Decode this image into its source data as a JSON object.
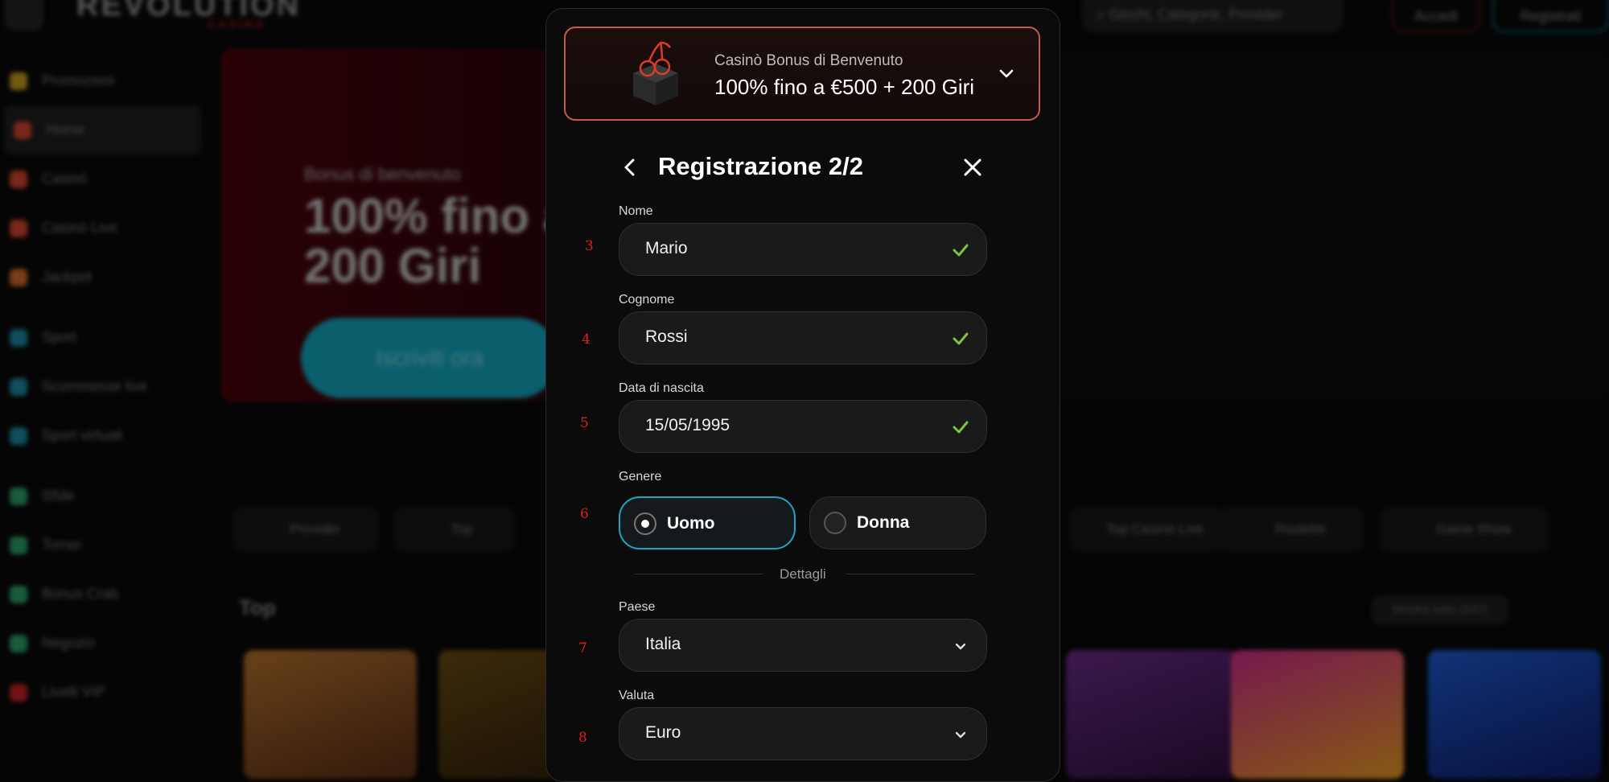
{
  "background": {
    "logo_main": "REVOLUTION",
    "logo_sub": "CASINO",
    "search_placeholder": "Giochi, Categorie, Provider",
    "login_label": "Accedi",
    "register_label": "Registrati",
    "sidebar": [
      {
        "label": "Promozioni",
        "color": "#c9a21b"
      },
      {
        "label": "Home",
        "color": "#d8452b"
      },
      {
        "label": "Casinò",
        "color": "#d8452b"
      },
      {
        "label": "Casinò Live",
        "color": "#d8452b"
      },
      {
        "label": "Jackpot",
        "color": "#d86a2b"
      },
      {
        "label": "Sport",
        "color": "#1a8aa3"
      },
      {
        "label": "Scommesse live",
        "color": "#1a8aa3"
      },
      {
        "label": "Sport virtuali",
        "color": "#1a8aa3"
      },
      {
        "label": "Sfide",
        "color": "#2ba36a"
      },
      {
        "label": "Tornei",
        "color": "#2ba36a"
      },
      {
        "label": "Bonus Crab",
        "color": "#2ba36a"
      },
      {
        "label": "Negozio",
        "color": "#2ba36a"
      },
      {
        "label": "Livelli VIP",
        "color": "#c92020"
      }
    ],
    "banner": {
      "small": "Bonus di benvenuto",
      "big": "100% fino a + 200 Giri",
      "cta": "Iscriviti ora"
    },
    "categories": [
      "Provider",
      "Top",
      "Top Casinò Live",
      "Roulette",
      "Game Show"
    ],
    "section_title": "Top",
    "show_all": "Mostra tutto (337)"
  },
  "modal": {
    "promo": {
      "subtitle": "Casinò Bonus di Benvenuto",
      "title": "100% fino a €500 + 200 Giri"
    },
    "header": {
      "title": "Registrazione 2/2"
    },
    "fields": {
      "first_name": {
        "label": "Nome",
        "value": "Mario",
        "marker": "3"
      },
      "last_name": {
        "label": "Cognome",
        "value": "Rossi",
        "marker": "4"
      },
      "birth_date": {
        "label": "Data di nascita",
        "value": "15/05/1995",
        "marker": "5"
      }
    },
    "gender": {
      "label": "Genere",
      "marker": "6",
      "options": [
        {
          "label": "Uomo",
          "selected": true
        },
        {
          "label": "Donna",
          "selected": false
        }
      ]
    },
    "divider": "Dettagli",
    "country": {
      "label": "Paese",
      "value": "Italia",
      "marker": "7"
    },
    "currency": {
      "label": "Valuta",
      "value": "Euro",
      "marker": "8"
    }
  },
  "colors": {
    "accent": "#1aa6c4",
    "promo_border": "#c9584a",
    "check": "#7cc243",
    "marker": "#e01e1e"
  }
}
